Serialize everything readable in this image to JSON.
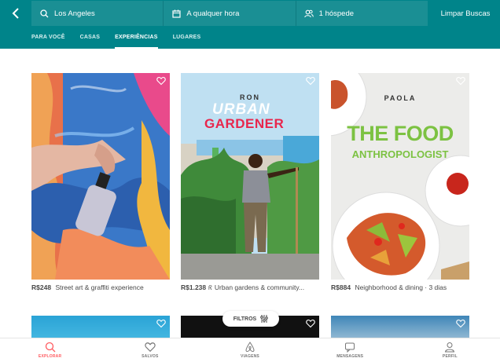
{
  "header": {
    "location": "Los Angeles",
    "dates": "A qualquer hora",
    "guests": "1 hóspede",
    "clear": "Limpar Buscas"
  },
  "tabs": [
    {
      "label": "PARA VOCÊ"
    },
    {
      "label": "CASAS"
    },
    {
      "label": "EXPERIÊNCIAS"
    },
    {
      "label": "LUGARES"
    }
  ],
  "cards": [
    {
      "price": "R$248",
      "title": "Street art & graffiti experience"
    },
    {
      "price": "R$1.238",
      "title": "Urban gardens & community..."
    },
    {
      "price": "R$884",
      "title": "Neighborhood & dining · 3 dias"
    }
  ],
  "posters": {
    "gardener": {
      "name": "RON",
      "line1": "URBAN",
      "line2": "GARDENER"
    },
    "food": {
      "name": "PAOLA",
      "line1": "THE FOOD",
      "line2": "ANTHROPOLOGIST"
    }
  },
  "filters": {
    "label": "FILTROS"
  },
  "nav": [
    {
      "label": "EXPLORAR",
      "icon": "search-icon"
    },
    {
      "label": "SALVOS",
      "icon": "heart-icon"
    },
    {
      "label": "VIAGENS",
      "icon": "airbnb-logo-icon"
    },
    {
      "label": "MENSAGENS",
      "icon": "message-icon"
    },
    {
      "label": "PERFIL",
      "icon": "profile-icon"
    }
  ],
  "colors": {
    "header": "#00848a",
    "accent": "#ff5a5f",
    "food_title": "#7cc242"
  }
}
